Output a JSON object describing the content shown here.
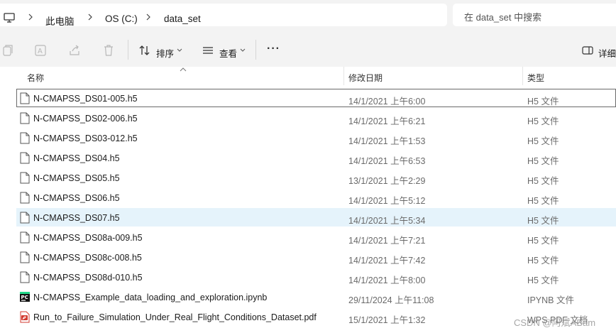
{
  "address": {
    "crumbs": [
      "此电脑",
      "OS (C:)",
      "data_set"
    ],
    "search_placeholder": "在 data_set 中搜索"
  },
  "toolbar": {
    "sort_label": "排序",
    "view_label": "查看",
    "details_label": "详细"
  },
  "columns": {
    "name": "名称",
    "date": "修改日期",
    "type": "类型"
  },
  "files": [
    {
      "name": "N-CMAPSS_DS01-005.h5",
      "date": "14/1/2021 上午6:00",
      "type": "H5 文件",
      "icon": "file-icon"
    },
    {
      "name": "N-CMAPSS_DS02-006.h5",
      "date": "14/1/2021 上午6:21",
      "type": "H5 文件",
      "icon": "file-icon"
    },
    {
      "name": "N-CMAPSS_DS03-012.h5",
      "date": "14/1/2021 上午1:53",
      "type": "H5 文件",
      "icon": "file-icon"
    },
    {
      "name": "N-CMAPSS_DS04.h5",
      "date": "14/1/2021 上午6:53",
      "type": "H5 文件",
      "icon": "file-icon"
    },
    {
      "name": "N-CMAPSS_DS05.h5",
      "date": "13/1/2021 上午2:29",
      "type": "H5 文件",
      "icon": "file-icon"
    },
    {
      "name": "N-CMAPSS_DS06.h5",
      "date": "14/1/2021 上午5:12",
      "type": "H5 文件",
      "icon": "file-icon"
    },
    {
      "name": "N-CMAPSS_DS07.h5",
      "date": "14/1/2021 上午5:34",
      "type": "H5 文件",
      "icon": "file-icon"
    },
    {
      "name": "N-CMAPSS_DS08a-009.h5",
      "date": "14/1/2021 上午7:21",
      "type": "H5 文件",
      "icon": "file-icon"
    },
    {
      "name": "N-CMAPSS_DS08c-008.h5",
      "date": "14/1/2021 上午7:42",
      "type": "H5 文件",
      "icon": "file-icon"
    },
    {
      "name": "N-CMAPSS_DS08d-010.h5",
      "date": "14/1/2021 上午8:00",
      "type": "H5 文件",
      "icon": "file-icon"
    },
    {
      "name": "N-CMAPSS_Example_data_loading_and_exploration.ipynb",
      "date": "29/11/2024 上午11:08",
      "type": "IPYNB 文件",
      "icon": "pycharm-icon"
    },
    {
      "name": "Run_to_Failure_Simulation_Under_Real_Flight_Conditions_Dataset.pdf",
      "date": "15/1/2021 上午1:32",
      "type": "WPS PDF 文档",
      "icon": "pdf-icon"
    }
  ],
  "watermark": "CSDN @阿斌ABam",
  "colors": {
    "hover": "#e5f3fb",
    "chrome": "#f3f3f3",
    "focus_border": "#6a6a6a"
  }
}
